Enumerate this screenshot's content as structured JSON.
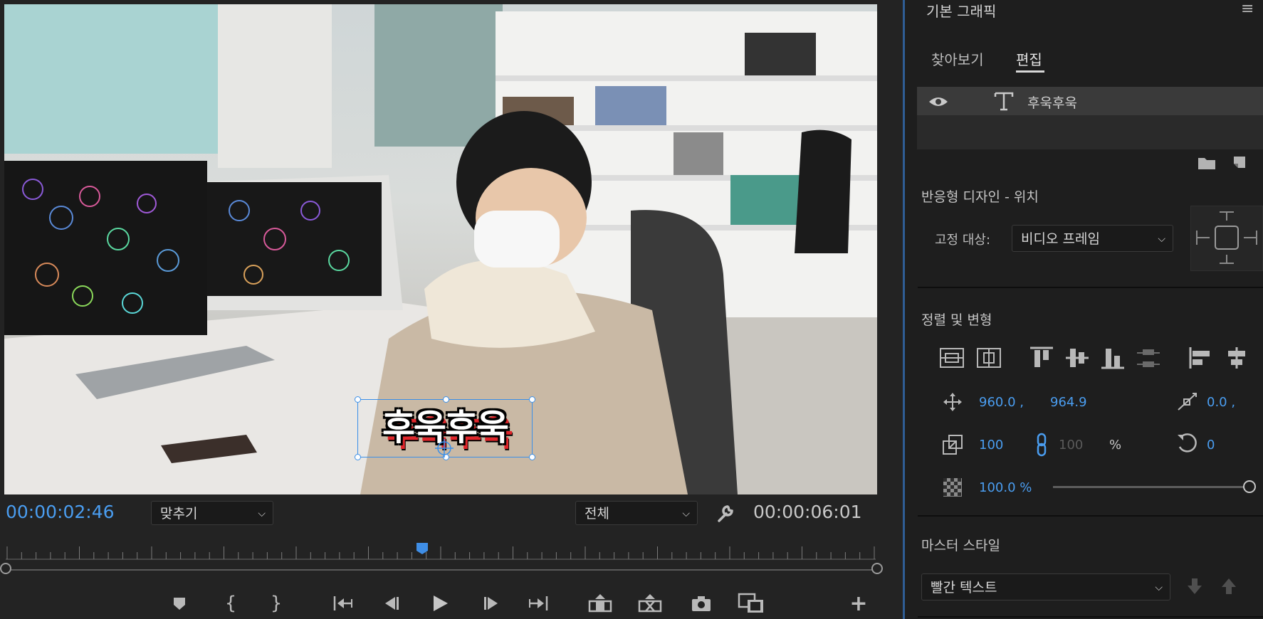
{
  "monitor": {
    "current_timecode": "00:00:02:46",
    "duration_timecode": "00:00:06:01",
    "fit_dropdown": "맞추기",
    "quality_dropdown": "전체",
    "caption_text": "후욱후욱"
  },
  "panel": {
    "title": "기본 그래픽",
    "tabs": [
      "찾아보기",
      "편집"
    ],
    "active_tab": "편집",
    "layer_name": "후욱후욱",
    "responsive_title": "반응형 디자인 - 위치",
    "pin_label": "고정 대상:",
    "pin_value": "비디오 프레임",
    "align_title": "정렬 및 변형",
    "position_x": "960.0 ,",
    "position_y": "964.9",
    "anchor_x": "0.0 ,",
    "scale_w": "100",
    "scale_h": "100",
    "scale_unit": "%",
    "rotation": "0",
    "opacity": "100.0 %",
    "opacity_value": 100,
    "master_style_title": "마스터 스타일",
    "master_style_value": "빨간 텍스트"
  },
  "colors": {
    "accent": "#4a9df0",
    "caption_shadow": "#e0262b"
  }
}
